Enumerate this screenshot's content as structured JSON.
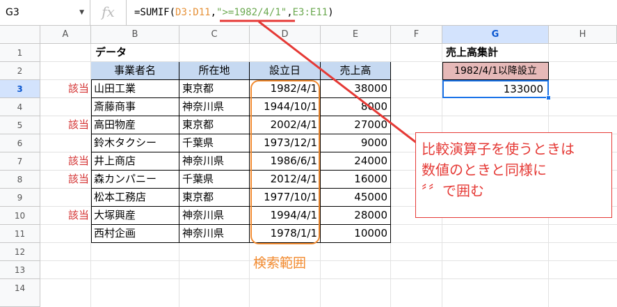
{
  "namebox": "G3",
  "fx_symbol": "fx",
  "formula": {
    "prefix": "=SUMIF(",
    "range": "D3:D11",
    "comma1": ",",
    "criteria": "\">=1982/4/1\"",
    "comma2": ",",
    "sum_range": "E3:E11",
    "suffix": ")"
  },
  "columns": [
    "A",
    "B",
    "C",
    "D",
    "E",
    "F",
    "G",
    "H"
  ],
  "rows": [
    "1",
    "2",
    "3",
    "4",
    "5",
    "6",
    "7",
    "8",
    "9",
    "10",
    "11",
    "12",
    "13",
    "14"
  ],
  "sheet": {
    "title": "データ",
    "headers": [
      "事業者名",
      "所在地",
      "設立日",
      "売上高"
    ],
    "records": [
      {
        "mark": "該当",
        "name": "山田工業",
        "loc": "東京都",
        "date": "1982/4/1",
        "sales": "38000"
      },
      {
        "mark": "",
        "name": "斎藤商事",
        "loc": "神奈川県",
        "date": "1944/10/1",
        "sales": "8000"
      },
      {
        "mark": "該当",
        "name": "高田物産",
        "loc": "東京都",
        "date": "2002/4/1",
        "sales": "27000"
      },
      {
        "mark": "",
        "name": "鈴木タクシー",
        "loc": "千葉県",
        "date": "1973/12/1",
        "sales": "9000"
      },
      {
        "mark": "該当",
        "name": "井上商店",
        "loc": "神奈川県",
        "date": "1986/6/1",
        "sales": "24000"
      },
      {
        "mark": "該当",
        "name": "森カンパニー",
        "loc": "千葉県",
        "date": "2012/4/1",
        "sales": "16000"
      },
      {
        "mark": "",
        "name": "松本工務店",
        "loc": "東京都",
        "date": "1977/10/1",
        "sales": "45000"
      },
      {
        "mark": "該当",
        "name": "大塚興産",
        "loc": "神奈川県",
        "date": "1994/4/1",
        "sales": "28000"
      },
      {
        "mark": "",
        "name": "西村企画",
        "loc": "神奈川県",
        "date": "1978/1/1",
        "sales": "10000"
      }
    ]
  },
  "summary": {
    "title": "売上高集計",
    "label": "1982/4/1以降設立",
    "value": "133000"
  },
  "search_range_label": "検索範囲",
  "callout": [
    "比較演算子を使うときは",
    "数値のときと同様に",
    "〞〞で囲む"
  ],
  "colors": {
    "header_fill": "#c6d9f1",
    "summary_fill": "#e6b9b8",
    "annotation_red": "#e53935",
    "range_orange": "#f28b30",
    "formula_orange": "#e69138",
    "formula_green": "#6aa84f",
    "selection_blue": "#1a73e8"
  }
}
